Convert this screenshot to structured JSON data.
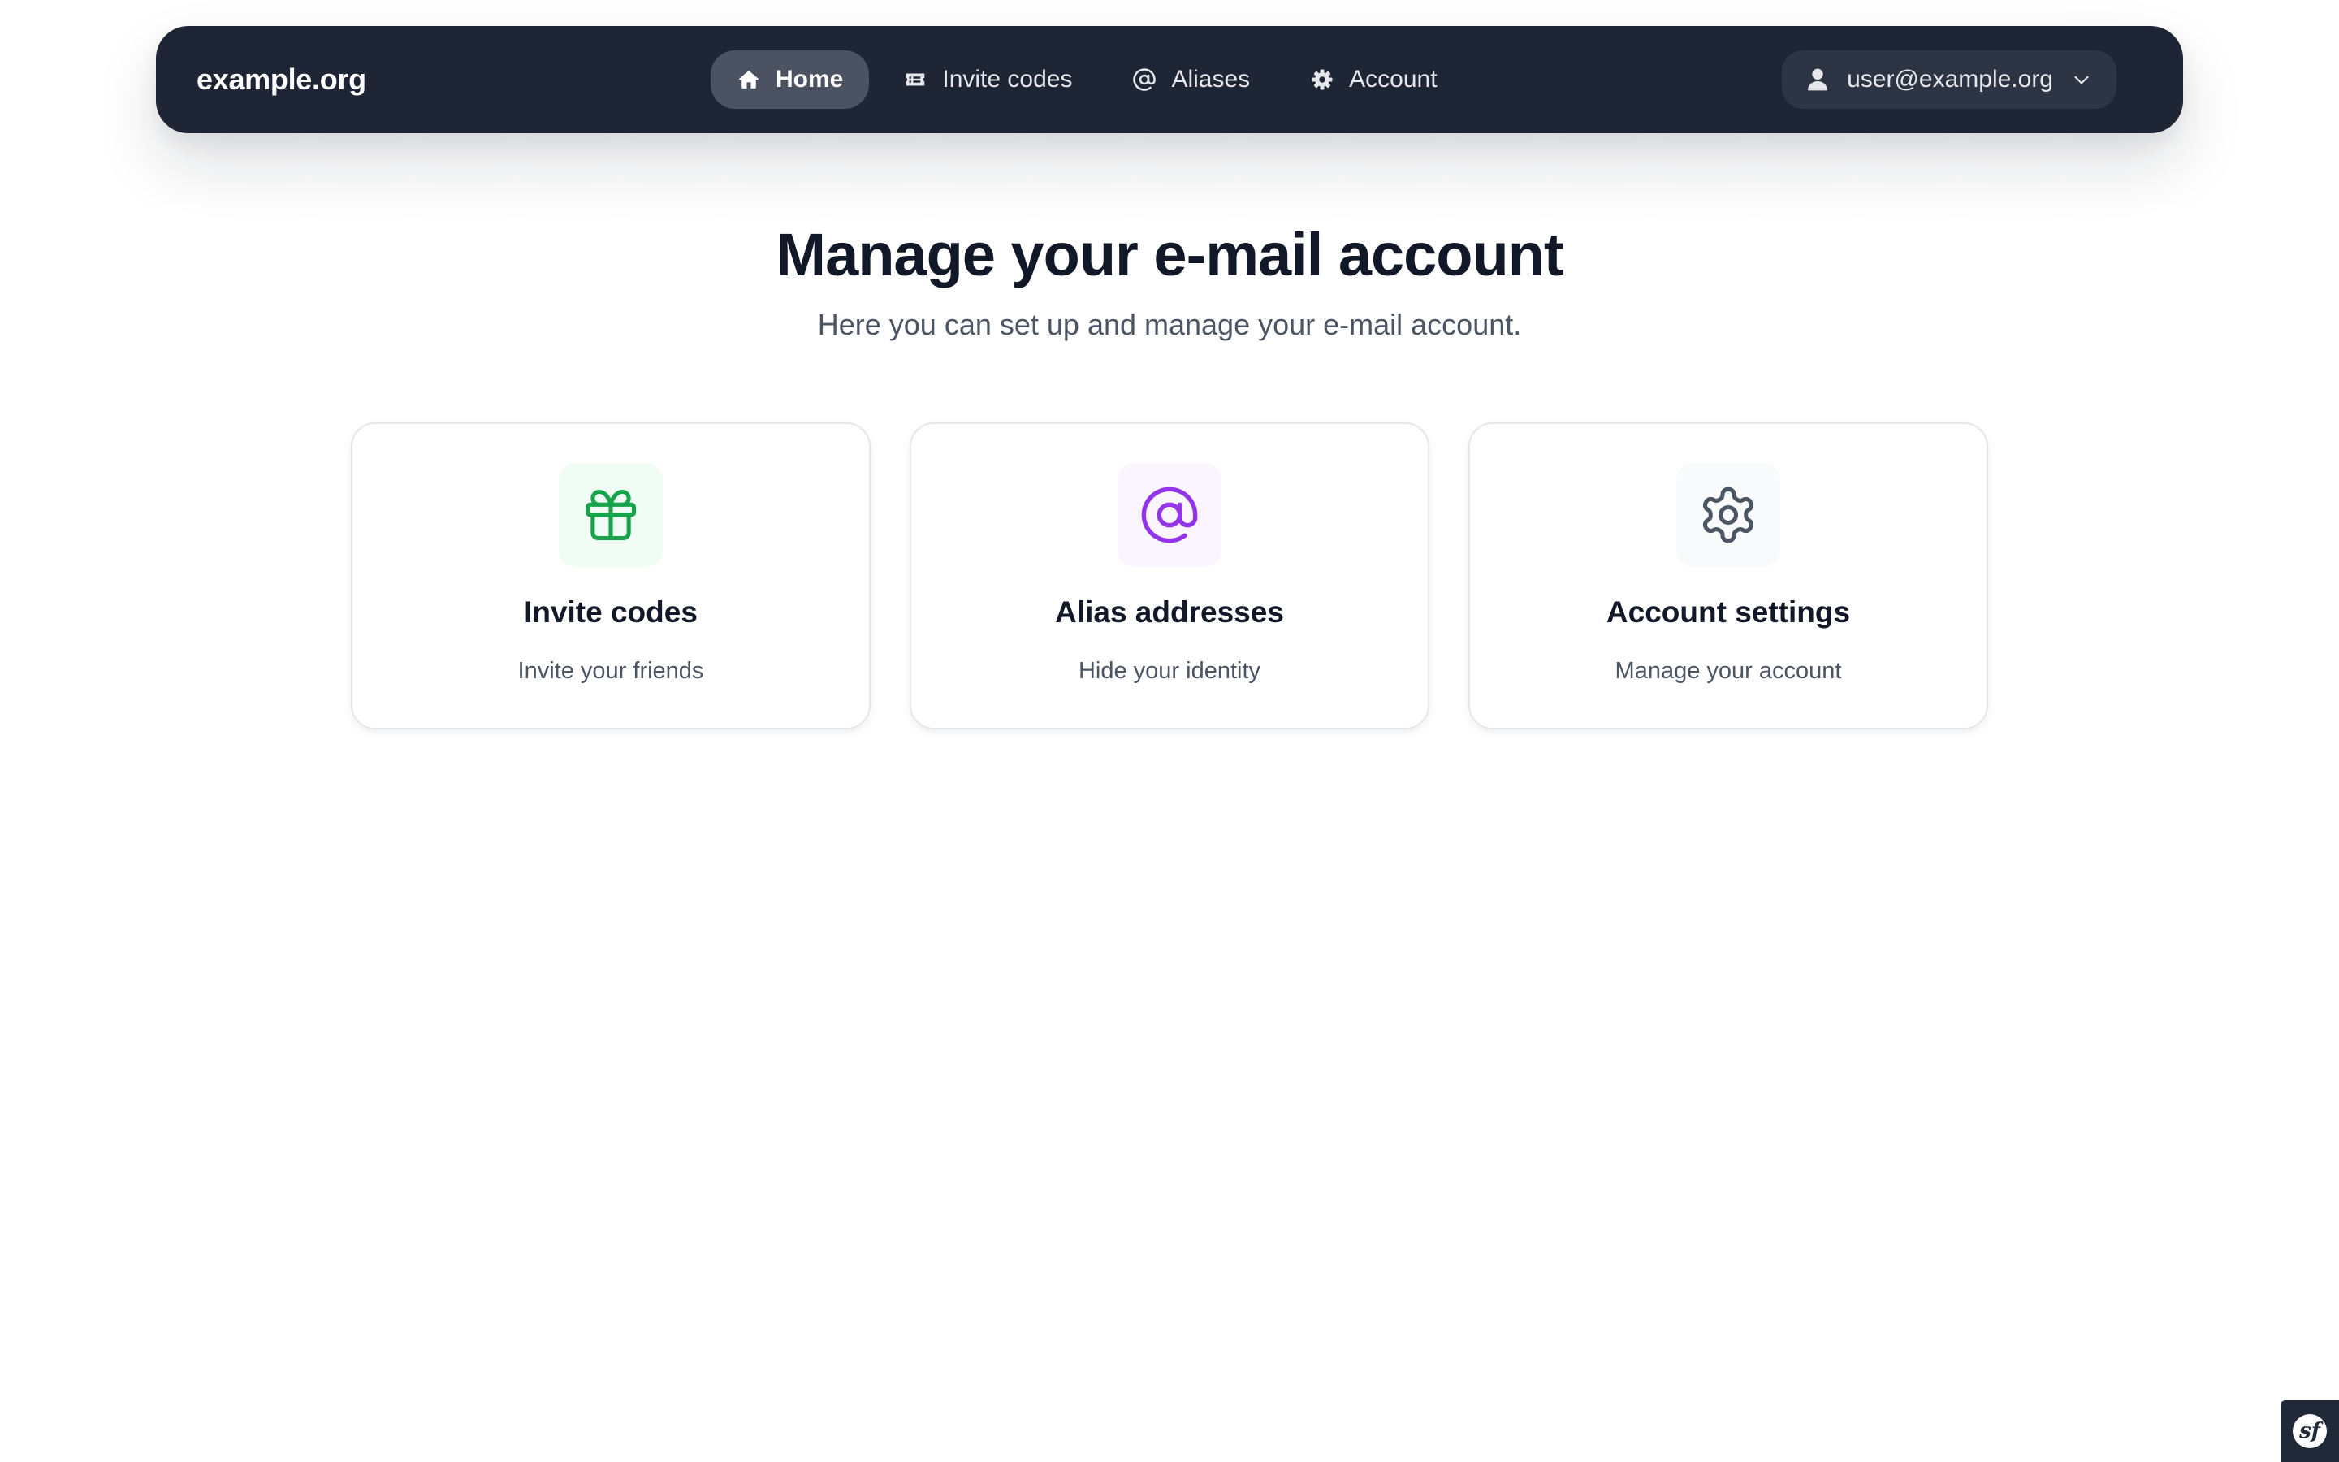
{
  "navbar": {
    "brand": "example.org",
    "items": [
      {
        "label": "Home",
        "icon": "home-icon",
        "active": true
      },
      {
        "label": "Invite codes",
        "icon": "ticket-icon",
        "active": false
      },
      {
        "label": "Aliases",
        "icon": "at-sign-icon",
        "active": false
      },
      {
        "label": "Account",
        "icon": "gear-icon",
        "active": false
      }
    ],
    "user": {
      "email": "user@example.org",
      "icon": "user-icon",
      "caret_icon": "chevron-down-icon"
    },
    "colors": {
      "background": "#1e2535",
      "active_item": "#4b5363",
      "user_menu": "#2d3443"
    }
  },
  "hero": {
    "title": "Manage your e-mail account",
    "subtitle": "Here you can set up and manage your e-mail account."
  },
  "cards": [
    {
      "title": "Invite codes",
      "description": "Invite your friends",
      "icon": "gift-icon",
      "icon_color": "#16a34a",
      "icon_bg": "#f0fdf4"
    },
    {
      "title": "Alias addresses",
      "description": "Hide your identity",
      "icon": "at-sign-icon",
      "icon_color": "#9333ea",
      "icon_bg": "#faf5ff"
    },
    {
      "title": "Account settings",
      "description": "Manage your account",
      "icon": "gear-icon",
      "icon_color": "#4b5563",
      "icon_bg": "#f9fafb"
    }
  ],
  "debug_toolbar": {
    "icon": "symfony-logo-icon",
    "glyph": "sf"
  }
}
